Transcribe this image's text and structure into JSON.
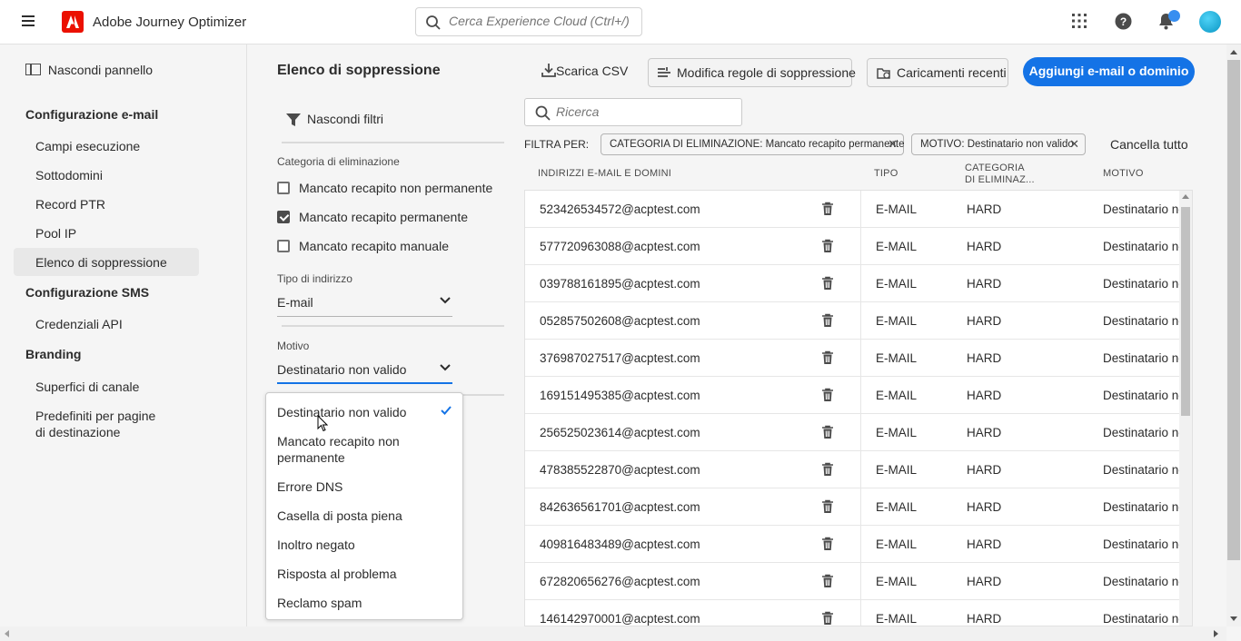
{
  "app": {
    "name": "Adobe Journey Optimizer",
    "search_placeholder": "Cerca Experience Cloud (Ctrl+/)"
  },
  "sidebar": {
    "hide_panel": "Nascondi pannello",
    "sections": [
      {
        "title": "Configurazione e-mail",
        "items": [
          "Campi esecuzione",
          "Sottodomini",
          "Record PTR",
          "Pool IP",
          "Elenco di soppressione"
        ]
      },
      {
        "title": "Configurazione SMS",
        "items": [
          "Credenziali API"
        ]
      },
      {
        "title": "Branding",
        "items": [
          "Superfici di canale",
          "Predefiniti per pagine",
          "di destinazione"
        ]
      }
    ],
    "active_item": "Elenco di soppressione"
  },
  "filters": {
    "page_title": "Elenco di soppressione",
    "hide_filters": "Nascondi filtri",
    "category_label": "Categoria di eliminazione",
    "categories": [
      {
        "label": "Mancato recapito non permanente",
        "checked": false
      },
      {
        "label": "Mancato recapito permanente",
        "checked": true
      },
      {
        "label": "Mancato recapito manuale",
        "checked": false
      }
    ],
    "address_type_label": "Tipo di indirizzo",
    "address_type_value": "E-mail",
    "reason_label": "Motivo",
    "reason_value": "Destinatario non valido",
    "reason_options": [
      "Destinatario non valido",
      "Mancato recapito non",
      "permanente",
      "Errore DNS",
      "Casella di posta piena",
      "Inoltro negato",
      "Risposta al problema",
      "Reclamo spam"
    ],
    "reason_selected": "Destinatario non valido"
  },
  "toolbar": {
    "download_csv": "Scarica CSV",
    "edit_rules": "Modifica regole di soppressione",
    "recent_uploads": "Caricamenti recenti",
    "add": "Aggiungi e-mail o dominio"
  },
  "search": {
    "placeholder": "Ricerca"
  },
  "filter_bar": {
    "label": "FILTRA PER:",
    "tags": [
      "CATEGORIA DI ELIMINAZIONE: Mancato recapito permanente",
      "MOTIVO: Destinatario non valido"
    ],
    "clear_all": "Cancella tutto"
  },
  "table": {
    "columns": [
      "INDIRIZZI E-MAIL E DOMINI",
      "TIPO",
      "CATEGORIA",
      "DI ELIMINAZ...",
      "MOTIVO"
    ],
    "rows": [
      {
        "address": "523426534572@acptest.com",
        "type": "E-MAIL",
        "category": "HARD",
        "reason": "Destinatario non valido"
      },
      {
        "address": "577720963088@acptest.com",
        "type": "E-MAIL",
        "category": "HARD",
        "reason": "Destinatario non valido"
      },
      {
        "address": "039788161895@acptest.com",
        "type": "E-MAIL",
        "category": "HARD",
        "reason": "Destinatario non valido"
      },
      {
        "address": "052857502608@acptest.com",
        "type": "E-MAIL",
        "category": "HARD",
        "reason": "Destinatario non valido"
      },
      {
        "address": "376987027517@acptest.com",
        "type": "E-MAIL",
        "category": "HARD",
        "reason": "Destinatario non valido"
      },
      {
        "address": "169151495385@acptest.com",
        "type": "E-MAIL",
        "category": "HARD",
        "reason": "Destinatario non valido"
      },
      {
        "address": "256525023614@acptest.com",
        "type": "E-MAIL",
        "category": "HARD",
        "reason": "Destinatario non valido"
      },
      {
        "address": "478385522870@acptest.com",
        "type": "E-MAIL",
        "category": "HARD",
        "reason": "Destinatario non valido"
      },
      {
        "address": "842636561701@acptest.com",
        "type": "E-MAIL",
        "category": "HARD",
        "reason": "Destinatario non valido"
      },
      {
        "address": "409816483489@acptest.com",
        "type": "E-MAIL",
        "category": "HARD",
        "reason": "Destinatario non valido"
      },
      {
        "address": "672820656276@acptest.com",
        "type": "E-MAIL",
        "category": "HARD",
        "reason": "Destinatario non valido"
      },
      {
        "address": "146142970001@acptest.com",
        "type": "E-MAIL",
        "category": "HARD",
        "reason": "Destinatario non valido"
      }
    ]
  },
  "colors": {
    "accent": "#1473e6",
    "brand": "#eb1000"
  }
}
